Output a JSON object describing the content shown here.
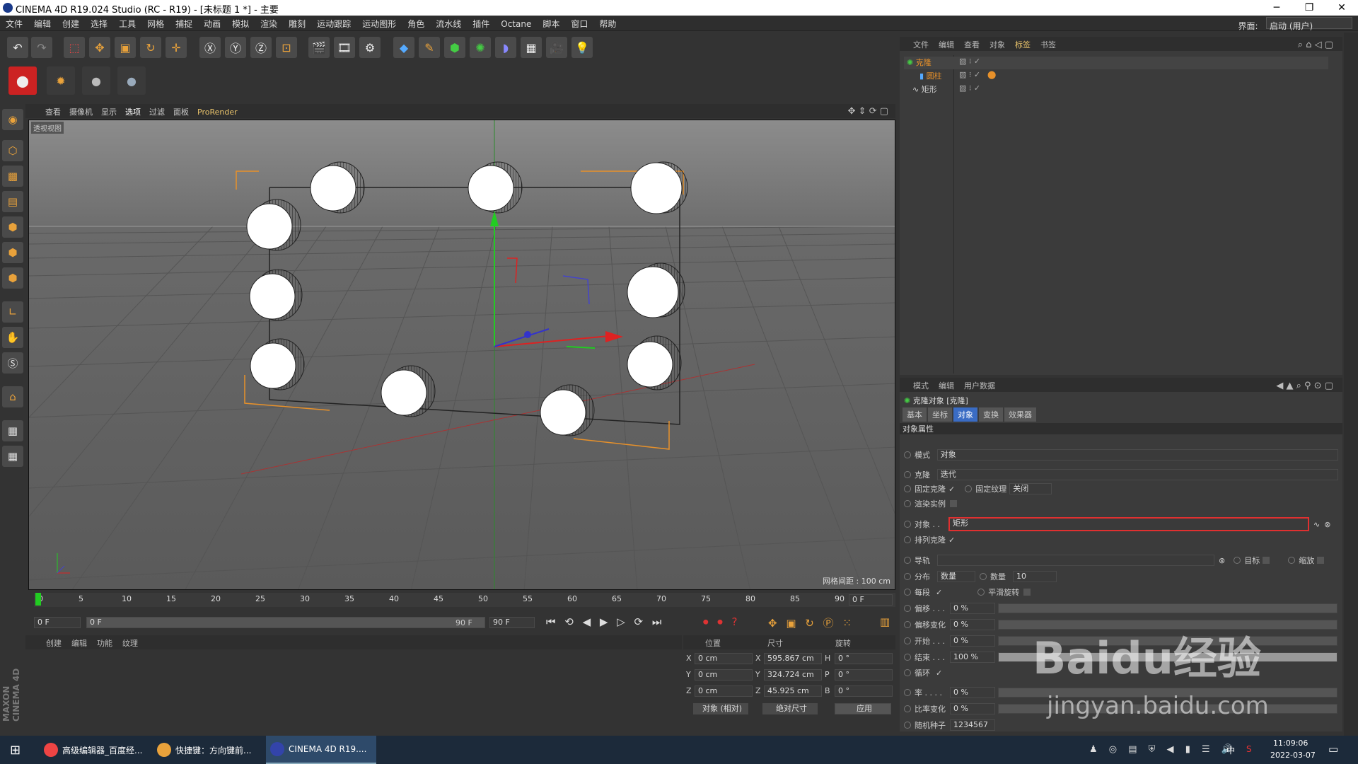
{
  "app": {
    "title": "CINEMA 4D R19.024 Studio (RC - R19) - [未标题 1 *] - 主要",
    "layout_label": "界面:",
    "layout_value": "启动 (用户)"
  },
  "menu": [
    "文件",
    "编辑",
    "创建",
    "选择",
    "工具",
    "网格",
    "捕捉",
    "动画",
    "模拟",
    "渲染",
    "雕刻",
    "运动跟踪",
    "运动图形",
    "角色",
    "流水线",
    "插件",
    "Octane",
    "脚本",
    "窗口",
    "帮助"
  ],
  "viewport": {
    "menu": [
      "查看",
      "摄像机",
      "显示",
      "选项",
      "过滤",
      "面板",
      "ProRender"
    ],
    "label": "透视视图",
    "grid_spacing": "网格间距 : 100 cm"
  },
  "object_manager": {
    "menu": [
      "文件",
      "编辑",
      "查看",
      "对象",
      "标签",
      "书签"
    ],
    "items": [
      {
        "name": "克隆",
        "level": 0
      },
      {
        "name": "圆柱",
        "level": 1
      },
      {
        "name": "矩形",
        "level": 0
      }
    ]
  },
  "attributes": {
    "menu": [
      "模式",
      "编辑",
      "用户数据"
    ],
    "title": "克隆对象 [克隆]",
    "tabs": [
      "基本",
      "坐标",
      "对象",
      "变换",
      "效果器"
    ],
    "active_tab": "对象",
    "section": "对象属性",
    "mode_label": "模式",
    "mode_value": "对象",
    "clone_label": "克隆",
    "clone_value": "迭代",
    "fix_clone": "固定克隆",
    "fix_texture": "固定纹理",
    "fix_texture_value": "关闭",
    "render_instances": "渲染实例",
    "object_label": "对象 . .",
    "object_value": "矩形",
    "arrange_clone": "排列克隆",
    "rail_label": "导轨",
    "target_label": "目标",
    "scale_label": "缩放",
    "distribution_label": "分布",
    "distribution_value": "数量",
    "count_label": "数量",
    "count_value": "10",
    "per_segment": "每段",
    "smooth_rotation": "平滑旋转",
    "rows": [
      {
        "label": "偏移 . . .",
        "value": "0 %"
      },
      {
        "label": "偏移变化",
        "value": "0 %"
      },
      {
        "label": "开始 . . .",
        "value": "0 %"
      },
      {
        "label": "结束 . . .",
        "value": "100 %"
      }
    ],
    "loop": "循环",
    "rows2": [
      {
        "label": "率 . . . .",
        "value": "0 %"
      },
      {
        "label": "比率变化",
        "value": "0 %"
      },
      {
        "label": "随机种子",
        "value": "1234567"
      }
    ]
  },
  "timeline": {
    "ticks": [
      "0",
      "5",
      "10",
      "15",
      "20",
      "25",
      "30",
      "35",
      "40",
      "45",
      "50",
      "55",
      "60",
      "65",
      "70",
      "75",
      "80",
      "85",
      "90"
    ],
    "end_field": "0 F",
    "start": "0 F",
    "range_start": "0 F",
    "range_end": "90 F",
    "max": "90 F"
  },
  "material_menu": [
    "创建",
    "编辑",
    "功能",
    "纹理"
  ],
  "coords": {
    "headers": [
      "位置",
      "尺寸",
      "旋转"
    ],
    "rows": [
      {
        "axis": "X",
        "pos": "0 cm",
        "size_axis": "X",
        "size": "595.867 cm",
        "rot_axis": "H",
        "rot": "0 °"
      },
      {
        "axis": "Y",
        "pos": "0 cm",
        "size_axis": "Y",
        "size": "324.724 cm",
        "rot_axis": "P",
        "rot": "0 °"
      },
      {
        "axis": "Z",
        "pos": "0 cm",
        "size_axis": "Z",
        "size": "45.925 cm",
        "rot_axis": "B",
        "rot": "0 °"
      }
    ],
    "mode": "对象 (相对)",
    "size_mode": "绝对尺寸",
    "apply": "应用"
  },
  "taskbar": {
    "items": [
      "高级编辑器_百度经...",
      "快捷键：方向键前...",
      "CINEMA 4D R19...."
    ],
    "ime": "中",
    "time": "11:09:06",
    "date": "2022-03-07"
  },
  "watermark": {
    "brand": "Baidu经验",
    "url": "jingyan.baidu.com"
  },
  "colors": {
    "accent": "#e8912a",
    "active_tab": "#3a6cc4",
    "highlight_box": "#e03030"
  }
}
